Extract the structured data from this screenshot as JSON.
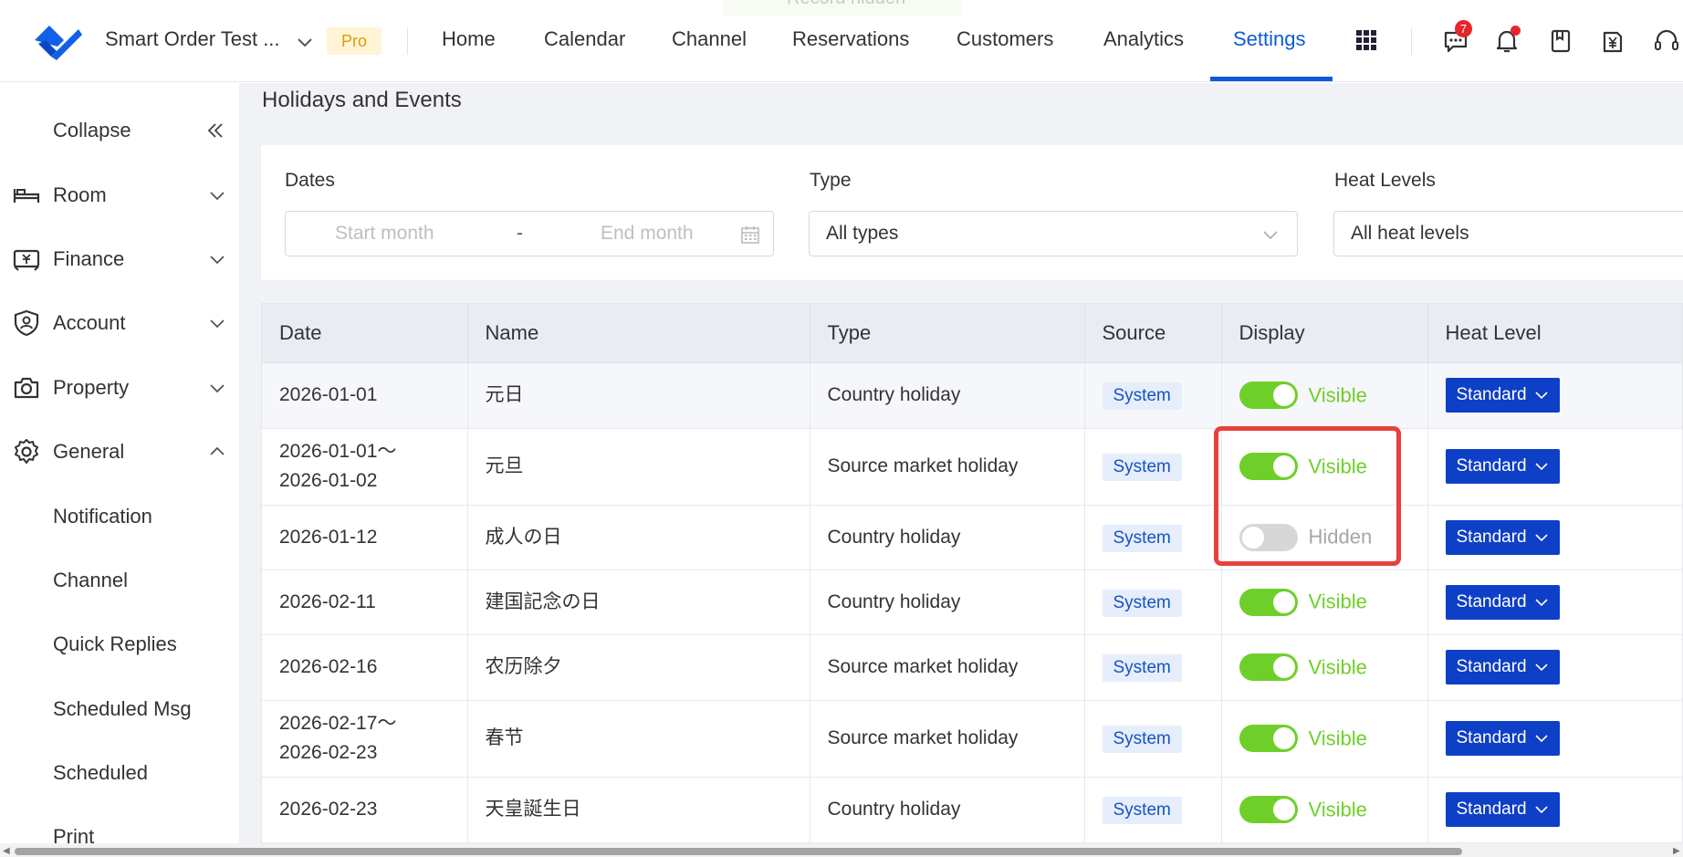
{
  "toast": {
    "text": "Record hidden"
  },
  "header": {
    "store_name": "Smart Order Test ...",
    "plan_badge": "Pro",
    "nav": [
      "Home",
      "Calendar",
      "Channel",
      "Reservations",
      "Customers",
      "Analytics",
      "Settings"
    ],
    "active_nav": "Settings",
    "message_badge_count": "7",
    "accent_color": "#0d5bd7"
  },
  "sidebar": {
    "collapse_label": "Collapse",
    "sections": [
      {
        "label": "Room",
        "icon": "bed-icon",
        "expanded": false
      },
      {
        "label": "Finance",
        "icon": "finance-icon",
        "expanded": false
      },
      {
        "label": "Account",
        "icon": "account-shield-icon",
        "expanded": false
      },
      {
        "label": "Property",
        "icon": "property-camera-icon",
        "expanded": false
      },
      {
        "label": "General",
        "icon": "gear-icon",
        "expanded": true
      }
    ],
    "general_items": [
      "Notification",
      "Channel",
      "Quick Replies",
      "Scheduled Msg",
      "Scheduled",
      "Print"
    ]
  },
  "page": {
    "title": "Holidays and Events"
  },
  "filters": {
    "dates_label": "Dates",
    "start_placeholder": "Start month",
    "range_separator": "-",
    "end_placeholder": "End month",
    "type_label": "Type",
    "type_value": "All types",
    "heat_label": "Heat Levels",
    "heat_value": "All heat levels"
  },
  "table": {
    "columns": [
      "Date",
      "Name",
      "Type",
      "Source",
      "Display",
      "Heat Level"
    ],
    "rows": [
      {
        "date1": "2026-01-01",
        "date2": "",
        "name": "元日",
        "type": "Country holiday",
        "source": "System",
        "display": "Visible",
        "on": true,
        "heat": "Standard"
      },
      {
        "date1": "2026-01-01～",
        "date2": "2026-01-02",
        "name": "元旦",
        "type": "Source market holiday",
        "source": "System",
        "display": "Visible",
        "on": true,
        "heat": "Standard"
      },
      {
        "date1": "2026-01-12",
        "date2": "",
        "name": "成人の日",
        "type": "Country holiday",
        "source": "System",
        "display": "Hidden",
        "on": false,
        "heat": "Standard"
      },
      {
        "date1": "2026-02-11",
        "date2": "",
        "name": "建国記念の日",
        "type": "Country holiday",
        "source": "System",
        "display": "Visible",
        "on": true,
        "heat": "Standard"
      },
      {
        "date1": "2026-02-16",
        "date2": "",
        "name": "农历除夕",
        "type": "Source market holiday",
        "source": "System",
        "display": "Visible",
        "on": true,
        "heat": "Standard"
      },
      {
        "date1": "2026-02-17～",
        "date2": "2026-02-23",
        "name": "春节",
        "type": "Source market holiday",
        "source": "System",
        "display": "Visible",
        "on": true,
        "heat": "Standard"
      },
      {
        "date1": "2026-02-23",
        "date2": "",
        "name": "天皇誕生日",
        "type": "Country holiday",
        "source": "System",
        "display": "Visible",
        "on": true,
        "heat": "Standard"
      }
    ]
  },
  "colors": {
    "toggle_on": "#6fcf2a",
    "heat_button": "#0e3fc7",
    "highlight": "#e8403d"
  }
}
